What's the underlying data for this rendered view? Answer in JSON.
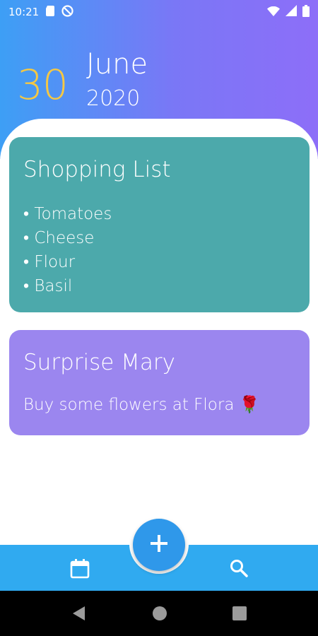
{
  "status_bar": {
    "time": "10:21"
  },
  "date": {
    "day": "30",
    "month": "June",
    "year": "2020"
  },
  "notes": [
    {
      "title": "Shopping List",
      "items": [
        "• Tomatoes",
        "• Cheese",
        "• Flour",
        "• Basil"
      ],
      "color": "#4ca9ab"
    },
    {
      "title": "Surprise Mary",
      "body": "Buy some flowers at Flora 🌹",
      "color": "#9b86ef"
    }
  ],
  "fab": {
    "label": "+",
    "icon": "plus-icon"
  },
  "bottom_nav": {
    "left_icon": "calendar-icon",
    "right_icon": "search-icon"
  },
  "colors": {
    "accent_yellow": "#f5c843",
    "bar_blue": "#30aaf0",
    "fab_blue": "#2f98ea"
  }
}
